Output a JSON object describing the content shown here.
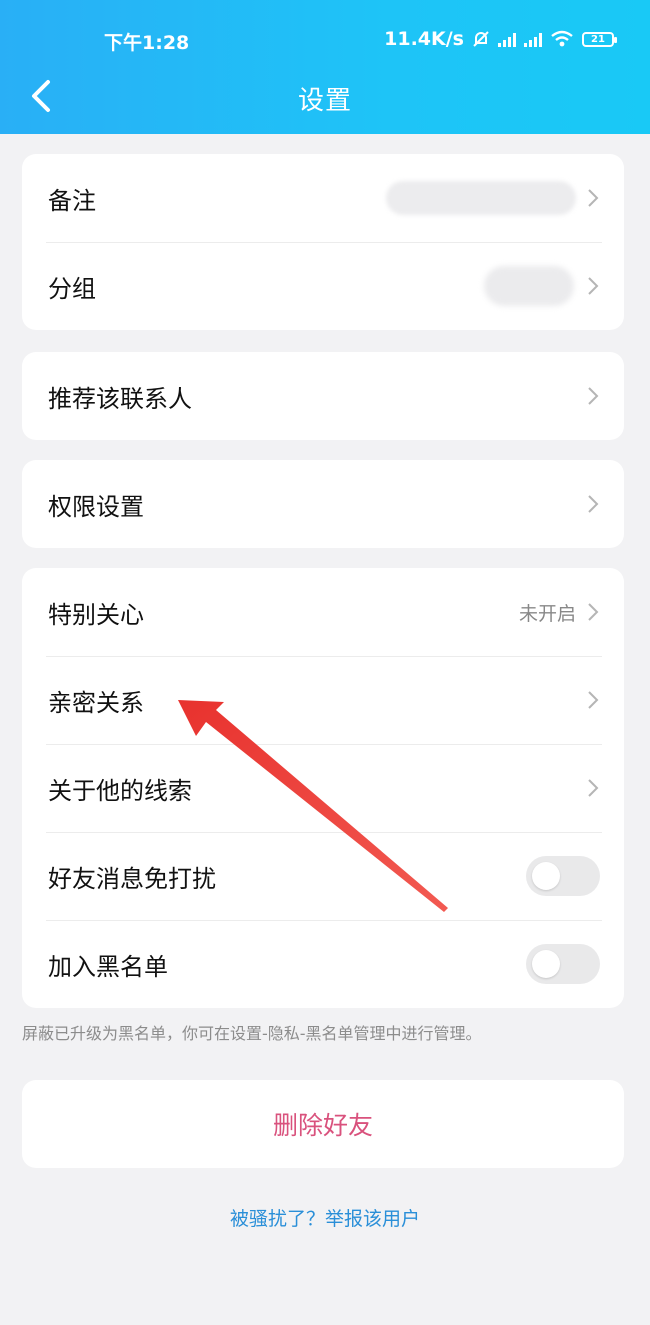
{
  "status_bar": {
    "time": "下午1:28",
    "speed": "11.4K/s",
    "battery": "21"
  },
  "header": {
    "title": "设置"
  },
  "groups": {
    "info": [
      {
        "label": "备注"
      },
      {
        "label": "分组"
      }
    ],
    "recommend": {
      "label": "推荐该联系人"
    },
    "permissions": {
      "label": "权限设置"
    },
    "relations": [
      {
        "label": "特别关心",
        "value": "未开启"
      },
      {
        "label": "亲密关系"
      },
      {
        "label": "关于他的线索"
      },
      {
        "label": "好友消息免打扰",
        "toggle": false
      },
      {
        "label": "加入黑名单",
        "toggle": false
      }
    ]
  },
  "block_note": "屏蔽已升级为黑名单，你可在设置-隐私-黑名单管理中进行管理。",
  "delete_button": "删除好友",
  "report_link": "被骚扰了？举报该用户",
  "colors": {
    "header_gradient_start": "#29aff6",
    "header_gradient_end": "#19c9f6",
    "delete_text": "#d9527d",
    "link_text": "#2a8fd8",
    "annotation_arrow": "#f0413c"
  }
}
